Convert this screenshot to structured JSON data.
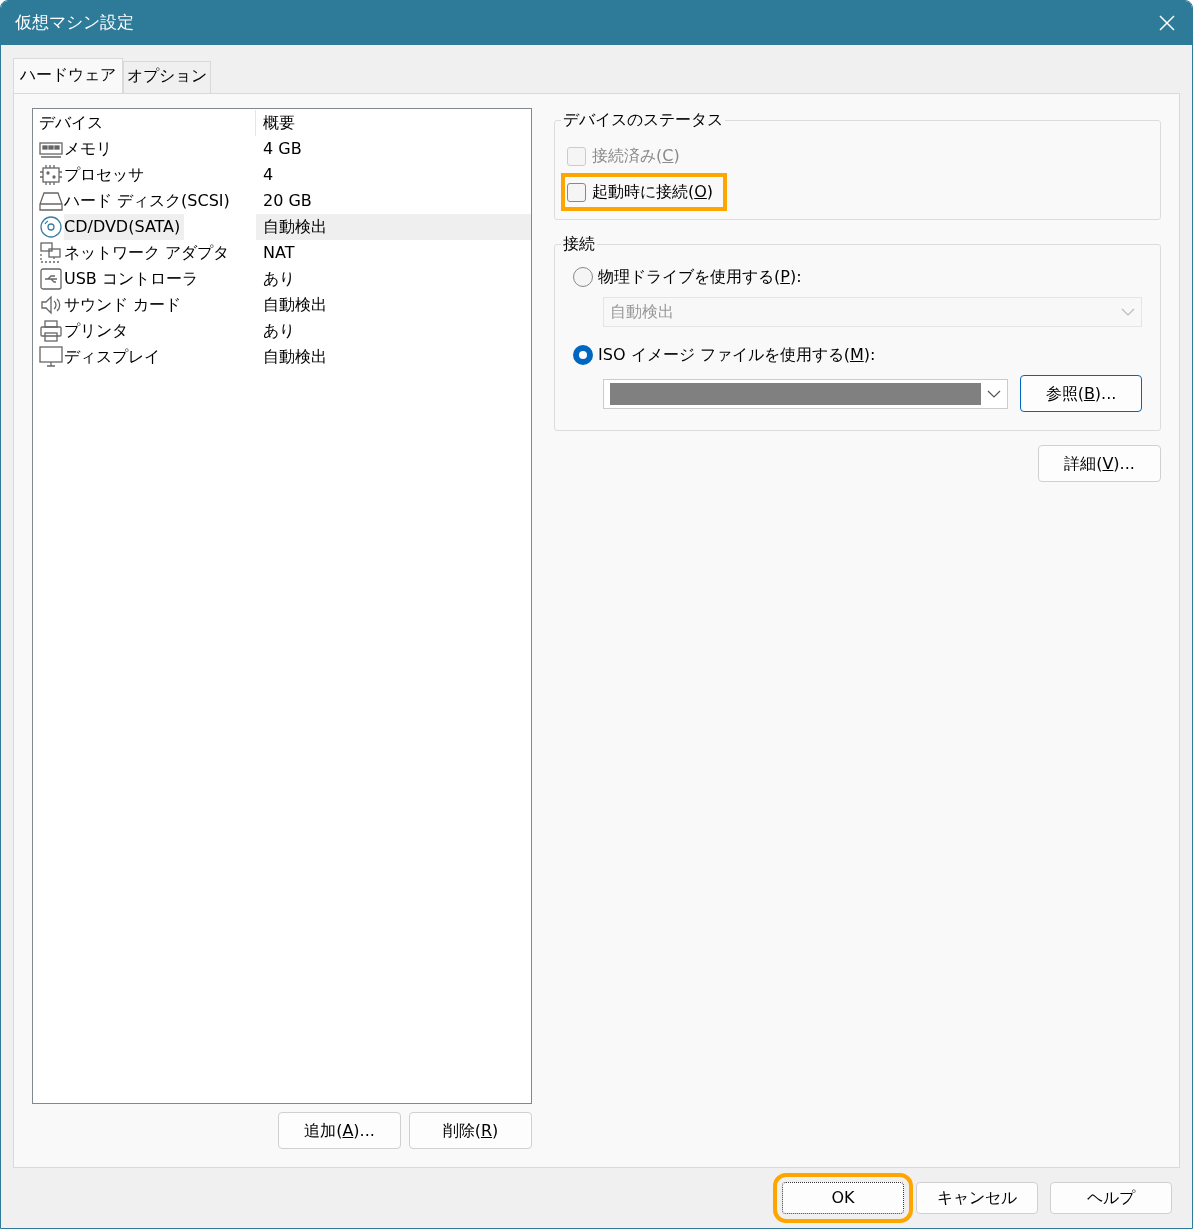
{
  "window": {
    "title": "仮想マシン設定"
  },
  "tabs": [
    {
      "label": "ハードウェア",
      "selected": true
    },
    {
      "label": "オプション",
      "selected": false
    }
  ],
  "device_list": {
    "columns": [
      "デバイス",
      "概要"
    ],
    "rows": [
      {
        "kind": "memory",
        "device": "メモリ",
        "summary": "4 GB",
        "selected": false
      },
      {
        "kind": "processor",
        "device": "プロセッサ",
        "summary": "4",
        "selected": false
      },
      {
        "kind": "disk",
        "device": "ハード ディスク(SCSI)",
        "summary": "20 GB",
        "selected": false
      },
      {
        "kind": "cd",
        "device": "CD/DVD(SATA)",
        "summary": "自動検出",
        "selected": true
      },
      {
        "kind": "network",
        "device": "ネットワーク アダプタ",
        "summary": "NAT",
        "selected": false
      },
      {
        "kind": "usb",
        "device": "USB コントローラ",
        "summary": "あり",
        "selected": false
      },
      {
        "kind": "sound",
        "device": "サウンド カード",
        "summary": "自動検出",
        "selected": false
      },
      {
        "kind": "printer",
        "device": "プリンタ",
        "summary": "あり",
        "selected": false
      },
      {
        "kind": "display",
        "device": "ディスプレイ",
        "summary": "自動検出",
        "selected": false
      }
    ]
  },
  "list_buttons": [
    {
      "before": "追加(",
      "key": "A",
      "after": ")..."
    },
    {
      "before": "削除(",
      "key": "R",
      "after": ")"
    }
  ],
  "device_status": {
    "title": "デバイスのステータス",
    "checkboxes": [
      {
        "before": "接続済み(",
        "key": "C",
        "after": ")",
        "checked": false,
        "disabled": true,
        "highlighted": false
      },
      {
        "before": "起動時に接続(",
        "key": "O",
        "after": ")",
        "checked": false,
        "disabled": false,
        "highlighted": true
      }
    ]
  },
  "connection": {
    "title": "接続",
    "options": [
      {
        "before": "物理ドライブを使用する(",
        "key": "P",
        "after": "):",
        "selected": false,
        "dropdown": {
          "value": "自動検出",
          "disabled": true,
          "redacted": false
        }
      },
      {
        "before": "ISO イメージ ファイルを使用する(",
        "key": "M",
        "after": "):",
        "selected": true,
        "dropdown": {
          "disabled": false,
          "redacted": true
        },
        "browse": {
          "before": "参照(",
          "key": "B",
          "after": ")..."
        }
      }
    ]
  },
  "advanced_button": {
    "before": "詳細(",
    "key": "V",
    "after": ")..."
  },
  "footer_buttons": [
    {
      "label": "OK",
      "highlighted": true
    },
    {
      "label": "キャンセル",
      "highlighted": false
    },
    {
      "label": "ヘルプ",
      "highlighted": false
    }
  ]
}
